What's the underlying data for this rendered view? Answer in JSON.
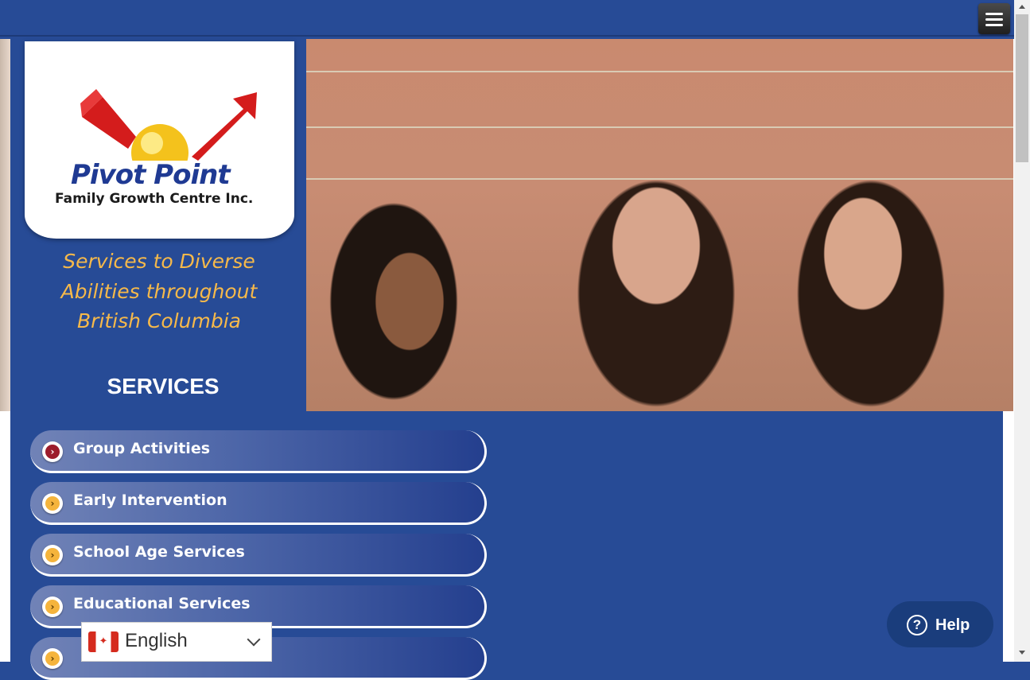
{
  "header": {
    "menu_icon": "hamburger-menu-icon"
  },
  "logo": {
    "name": "Pivot Point",
    "subtitle": "Family Growth Centre Inc."
  },
  "tagline": "Services to Diverse Abilities throughout British Columbia",
  "services": {
    "title": "SERVICES",
    "items": [
      {
        "label": "Group Activities",
        "active": true
      },
      {
        "label": "Early Intervention",
        "active": false
      },
      {
        "label": "School Age Services",
        "active": false
      },
      {
        "label": "Educational Services",
        "active": false
      },
      {
        "label": "",
        "active": false
      }
    ]
  },
  "language": {
    "selected": "English",
    "flag_icon": "canada-flag-icon"
  },
  "help": {
    "label": "Help"
  },
  "colors": {
    "background": "#274b96",
    "tagline": "#f6b94a",
    "help_button": "#1a3d7c"
  }
}
